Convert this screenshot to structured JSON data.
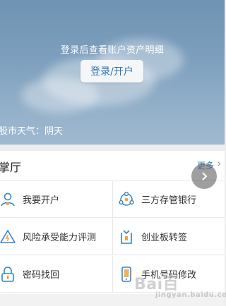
{
  "hero": {
    "tip": "登录后查看账户资产明细",
    "login_button": "登录/开户",
    "weather": "股市天气：阴天"
  },
  "hall": {
    "title": "掌厅",
    "more": "更多",
    "items": [
      {
        "label": "我要开户",
        "icon": "user-add-icon"
      },
      {
        "label": "三方存管银行",
        "icon": "bank-triangle-icon"
      },
      {
        "label": "风险承受能力评测",
        "icon": "warning-triangle-icon"
      },
      {
        "label": "创业板转签",
        "icon": "document-tag-icon"
      },
      {
        "label": "密码找回",
        "icon": "lock-icon"
      },
      {
        "label": "手机号码修改",
        "icon": "mobile-phone-icon"
      }
    ]
  },
  "colors": {
    "accent": "#2a78b8",
    "icon_blue": "#2f86c8",
    "icon_orange": "#f3a23a"
  },
  "watermark": {
    "brand": "Bai",
    "brand_suffix": "百",
    "sub": "jingyan.baidu.com"
  }
}
